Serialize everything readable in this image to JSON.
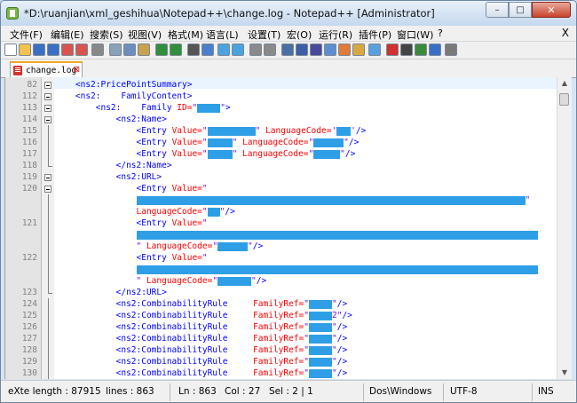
{
  "window": {
    "title": "*D:\\ruanjian\\xml_geshihua\\Notepad++\\change.log - Notepad++ [Administrator]",
    "controls": {
      "minimize": "–",
      "maximize": "□",
      "close": "✕"
    }
  },
  "menu": {
    "items": [
      "文件(F)",
      "编辑(E)",
      "搜索(S)",
      "视图(V)",
      "格式(M)",
      "语言(L)",
      "设置(T)",
      "宏(O)",
      "运行(R)",
      "插件(P)",
      "窗口(W)",
      "?"
    ],
    "close_label": "X"
  },
  "toolbar": {
    "icons": [
      "new-file-icon",
      "open-file-icon",
      "save-icon",
      "save-all-icon",
      "close-icon",
      "close-all-icon",
      "print-icon",
      "cut-icon",
      "copy-icon",
      "paste-icon",
      "undo-icon",
      "redo-icon",
      "find-icon",
      "replace-icon",
      "zoom-in-icon",
      "zoom-out-icon",
      "sync-v-icon",
      "sync-h-icon",
      "word-wrap-icon",
      "show-all-chars-icon",
      "indent-guide-icon",
      "doc-map-icon",
      "function-list-icon",
      "folder-workspace-icon",
      "monitor-icon",
      "record-macro-icon",
      "stop-macro-icon",
      "play-macro-icon",
      "run-macro-multiple-icon",
      "save-macro-icon"
    ]
  },
  "tab": {
    "label": "change.log",
    "close": "⊠"
  },
  "editor": {
    "lines": [
      {
        "num": "82",
        "fold": "box",
        "parts": [
          [
            "t",
            "    <ns2:PricePointSummary>"
          ]
        ]
      },
      {
        "num": "112",
        "fold": "box",
        "parts": [
          [
            "t",
            "    <ns2:    FamilyContent>"
          ]
        ]
      },
      {
        "num": "113",
        "fold": "box",
        "parts": [
          [
            "t",
            "        <ns2:    Family "
          ],
          [
            "a",
            "ID="
          ],
          [
            "v",
            "\""
          ],
          [
            "r",
            26
          ],
          [
            "v",
            "\""
          ],
          [
            "t",
            ">"
          ]
        ]
      },
      {
        "num": "114",
        "fold": "box",
        "parts": [
          [
            "t",
            "            <ns2:Name>"
          ]
        ]
      },
      {
        "num": "115",
        "fold": "line",
        "parts": [
          [
            "t",
            "                <Entry "
          ],
          [
            "a",
            "Value="
          ],
          [
            "v",
            "\""
          ],
          [
            "r",
            54
          ],
          [
            "v",
            "\""
          ],
          [
            "a",
            " LanguageCode="
          ],
          [
            "v",
            "'"
          ],
          [
            "r",
            16
          ],
          [
            "v",
            "'"
          ],
          [
            "t",
            "/>"
          ]
        ]
      },
      {
        "num": "116",
        "fold": "line",
        "parts": [
          [
            "t",
            "                <Entry "
          ],
          [
            "a",
            "Value="
          ],
          [
            "v",
            "\""
          ],
          [
            "r",
            28
          ],
          [
            "v",
            "\""
          ],
          [
            "a",
            " LanguageCode="
          ],
          [
            "v",
            "\""
          ],
          [
            "r",
            34
          ],
          [
            "v",
            "\""
          ],
          [
            "t",
            "/>"
          ]
        ]
      },
      {
        "num": "117",
        "fold": "line",
        "parts": [
          [
            "t",
            "                <Entry "
          ],
          [
            "a",
            "Value="
          ],
          [
            "v",
            "\""
          ],
          [
            "r",
            28
          ],
          [
            "v",
            "\""
          ],
          [
            "a",
            " LanguageCode="
          ],
          [
            "v",
            "\""
          ],
          [
            "r",
            30
          ],
          [
            "v",
            "\""
          ],
          [
            "t",
            "/>"
          ]
        ]
      },
      {
        "num": "118",
        "fold": "end",
        "parts": [
          [
            "t",
            "            </ns2:Name>"
          ]
        ]
      },
      {
        "num": "119",
        "fold": "box",
        "parts": [
          [
            "t",
            "            <ns2:URL>"
          ]
        ]
      },
      {
        "num": "120",
        "fold": "box",
        "parts": [
          [
            "t",
            "                <Entry "
          ],
          [
            "a",
            "Value="
          ],
          [
            "v",
            "\""
          ]
        ]
      },
      {
        "num": "",
        "fold": "line",
        "parts": [
          [
            "t",
            "                "
          ],
          [
            "r",
            438
          ],
          [
            "v",
            "\""
          ]
        ]
      },
      {
        "num": "",
        "fold": "line",
        "parts": [
          [
            "a",
            "                LanguageCode="
          ],
          [
            "v",
            "\""
          ],
          [
            "r",
            14
          ],
          [
            "v",
            "\""
          ],
          [
            "t",
            "/>"
          ]
        ]
      },
      {
        "num": "121",
        "fold": "line",
        "parts": [
          [
            "t",
            "                <Entry "
          ],
          [
            "a",
            "Value="
          ],
          [
            "v",
            "\""
          ]
        ]
      },
      {
        "num": "",
        "fold": "line",
        "parts": [
          [
            "t",
            "                "
          ],
          [
            "r",
            452
          ]
        ]
      },
      {
        "num": "",
        "fold": "line",
        "parts": [
          [
            "v",
            "                \""
          ],
          [
            "a",
            " LanguageCode="
          ],
          [
            "v",
            "\""
          ],
          [
            "r",
            34
          ],
          [
            "v",
            "\""
          ],
          [
            "t",
            "/>"
          ]
        ]
      },
      {
        "num": "122",
        "fold": "line",
        "parts": [
          [
            "t",
            "                <Entry "
          ],
          [
            "a",
            "Value="
          ],
          [
            "v",
            "\""
          ]
        ]
      },
      {
        "num": "",
        "fold": "line",
        "parts": [
          [
            "t",
            "                "
          ],
          [
            "r",
            452
          ]
        ]
      },
      {
        "num": "",
        "fold": "line",
        "parts": [
          [
            "v",
            "                \""
          ],
          [
            "a",
            " LanguageCode="
          ],
          [
            "v",
            "\""
          ],
          [
            "r",
            38
          ],
          [
            "v",
            "\""
          ],
          [
            "t",
            "/>"
          ]
        ]
      },
      {
        "num": "123",
        "fold": "end",
        "parts": [
          [
            "t",
            "            </ns2:URL>"
          ]
        ]
      },
      {
        "num": "124",
        "fold": "line",
        "parts": [
          [
            "t",
            "            <ns2:CombinabilityRule     "
          ],
          [
            "a",
            "FamilyRef="
          ],
          [
            "v",
            "\""
          ],
          [
            "r",
            26
          ],
          [
            "v",
            "\""
          ],
          [
            "t",
            "/>"
          ]
        ]
      },
      {
        "num": "125",
        "fold": "line",
        "parts": [
          [
            "t",
            "            <ns2:CombinabilityRule     "
          ],
          [
            "a",
            "FamilyRef="
          ],
          [
            "v",
            "\""
          ],
          [
            "r",
            26
          ],
          [
            "v",
            "2\""
          ],
          [
            "t",
            "/>"
          ]
        ]
      },
      {
        "num": "126",
        "fold": "line",
        "parts": [
          [
            "t",
            "            <ns2:CombinabilityRule     "
          ],
          [
            "a",
            "FamilyRef="
          ],
          [
            "v",
            "\""
          ],
          [
            "r",
            26
          ],
          [
            "v",
            "\""
          ],
          [
            "t",
            "/>"
          ]
        ]
      },
      {
        "num": "127",
        "fold": "line",
        "parts": [
          [
            "t",
            "            <ns2:CombinabilityRule     "
          ],
          [
            "a",
            "FamilyRef="
          ],
          [
            "v",
            "\""
          ],
          [
            "r",
            26
          ],
          [
            "v",
            "\""
          ],
          [
            "t",
            "/>"
          ]
        ]
      },
      {
        "num": "128",
        "fold": "line",
        "parts": [
          [
            "t",
            "            <ns2:CombinabilityRule     "
          ],
          [
            "a",
            "FamilyRef="
          ],
          [
            "v",
            "\""
          ],
          [
            "r",
            26
          ],
          [
            "v",
            "\""
          ],
          [
            "t",
            "/>"
          ]
        ]
      },
      {
        "num": "129",
        "fold": "line",
        "parts": [
          [
            "t",
            "            <ns2:CombinabilityRule     "
          ],
          [
            "a",
            "FamilyRef="
          ],
          [
            "v",
            "\""
          ],
          [
            "r",
            26
          ],
          [
            "v",
            "\""
          ],
          [
            "t",
            "/>"
          ]
        ]
      },
      {
        "num": "130",
        "fold": "line",
        "parts": [
          [
            "t",
            "            <ns2:CombinabilityRule     "
          ],
          [
            "a",
            "FamilyRef="
          ],
          [
            "v",
            "\""
          ],
          [
            "r",
            26
          ],
          [
            "v",
            "\""
          ],
          [
            "t",
            "/>"
          ]
        ]
      }
    ]
  },
  "status": {
    "type": "eXte length : 87915",
    "lines": "lines : 863",
    "ln": "Ln : 863",
    "col": "Col : 27",
    "sel": "Sel : 2 | 1",
    "eol": "Dos\\Windows",
    "encoding": "UTF-8",
    "mode": "INS"
  },
  "colors": {
    "tag": "#0000ff",
    "attr": "#ff0000",
    "value": "#8000ff",
    "redaction": "#2e9fe6"
  }
}
